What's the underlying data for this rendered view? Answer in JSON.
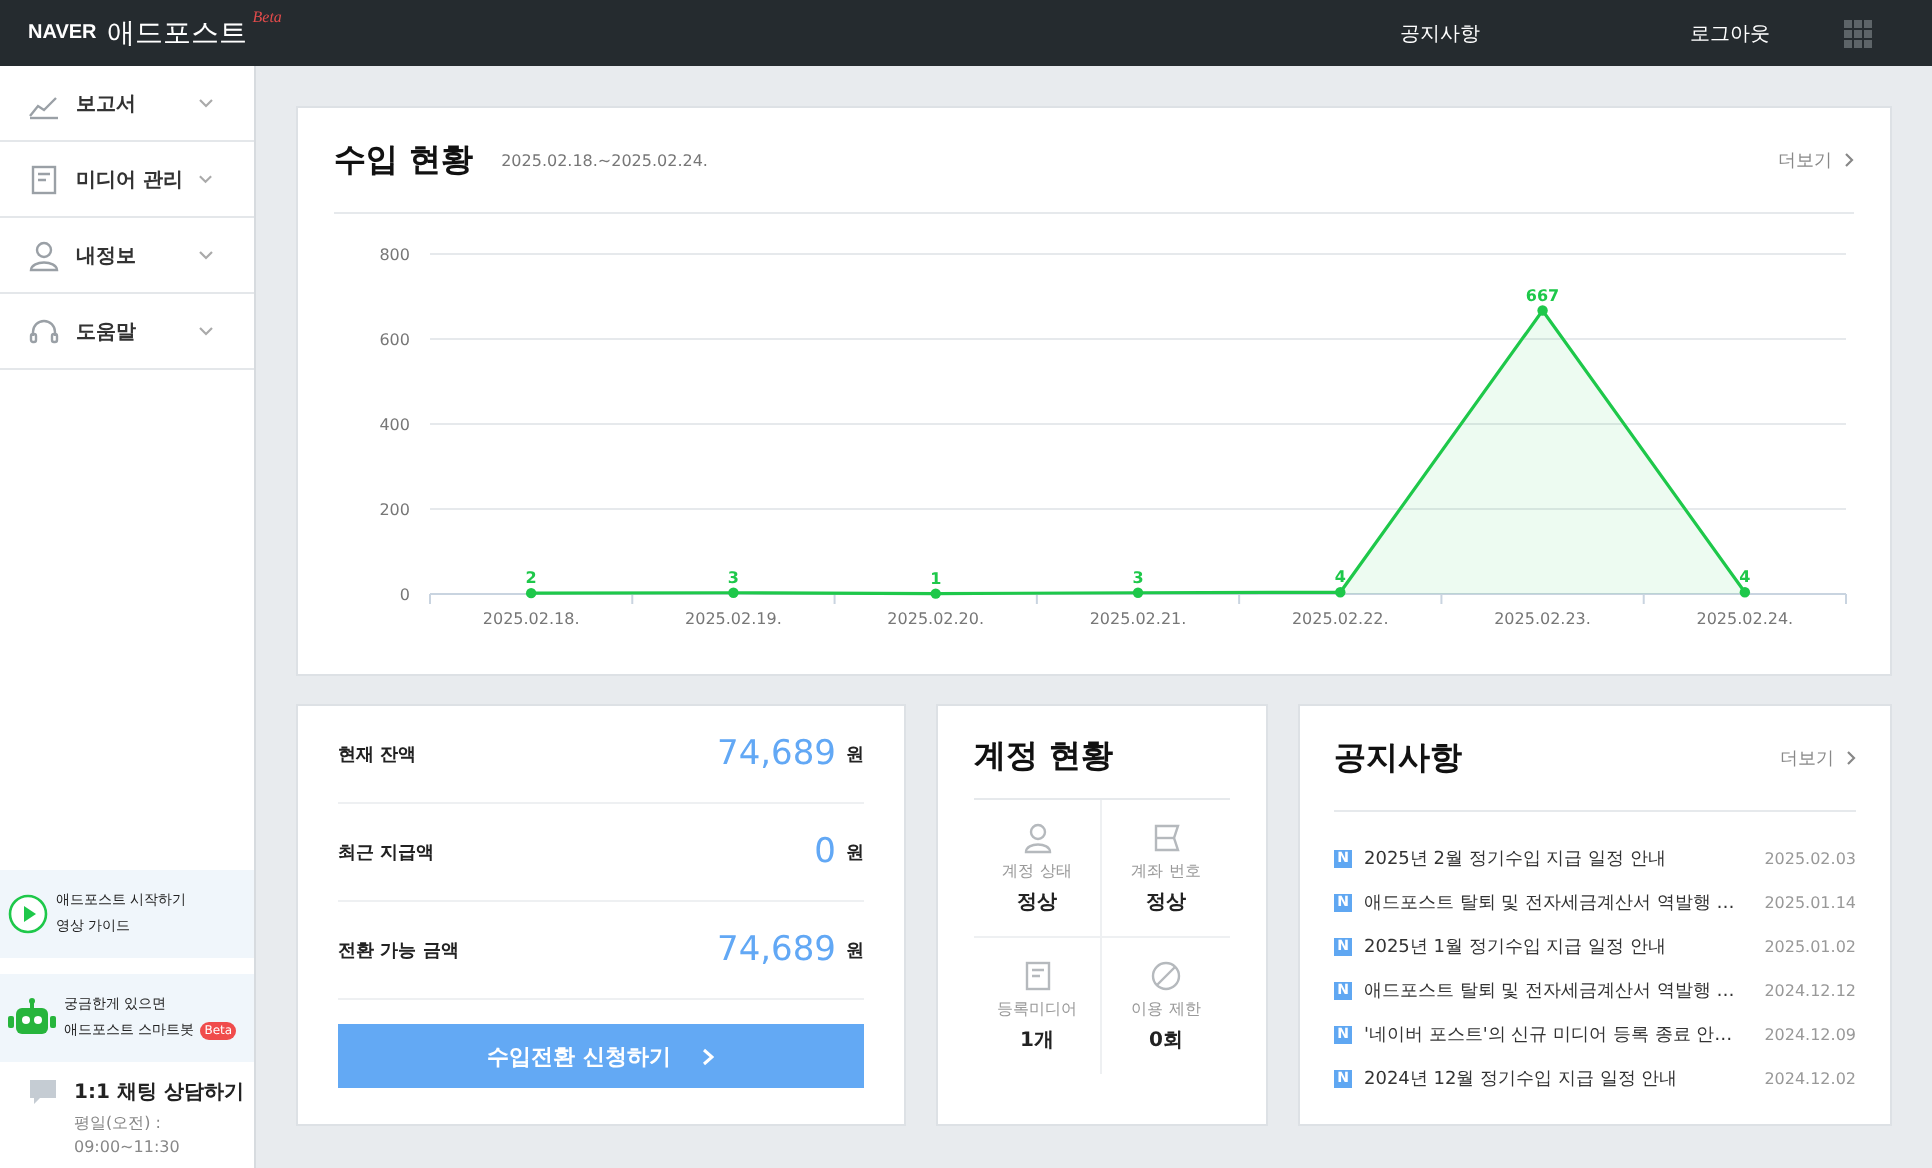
{
  "header": {
    "brand": "NAVER",
    "product": "애드포스트",
    "beta": "Beta",
    "links": [
      "공지사항",
      "로그아웃"
    ]
  },
  "sidebar": {
    "menu": [
      {
        "label": "보고서",
        "kind": "chart"
      },
      {
        "label": "미디어 관리",
        "kind": "document"
      },
      {
        "label": "내정보",
        "kind": "person"
      },
      {
        "label": "도움말",
        "kind": "headset"
      }
    ],
    "guide": [
      "애드포스트 시작하기",
      "영상 가이드"
    ],
    "bot": {
      "line1": "궁금한게 있으면",
      "line2": "애드포스트 스마트봇",
      "badge": "Beta"
    },
    "chat": {
      "title": "1:1 채팅 상담하기",
      "hours": [
        "평일(오전) :",
        "09:00~11:30"
      ]
    }
  },
  "income": {
    "title": "수입 현황",
    "period": "2025.02.18.~2025.02.24.",
    "more": "더보기",
    "chart_data": {
      "type": "area",
      "categories": [
        "2025.02.18.",
        "2025.02.19.",
        "2025.02.20.",
        "2025.02.21.",
        "2025.02.22.",
        "2025.02.23.",
        "2025.02.24."
      ],
      "series": [
        {
          "color": "#1ec84a",
          "values": [
            2,
            3,
            1,
            3,
            4,
            667,
            4
          ]
        }
      ],
      "ylim": [
        0,
        800
      ],
      "yticks": [
        0,
        200,
        400,
        600,
        800
      ],
      "grid": true,
      "data_labels": true
    }
  },
  "balance": {
    "rows": [
      {
        "label": "현재 잔액",
        "amount": "74,689",
        "unit": "원"
      },
      {
        "label": "최근 지급액",
        "amount": "0",
        "unit": "원"
      },
      {
        "label": "전환 가능 금액",
        "amount": "74,689",
        "unit": "원"
      }
    ],
    "button": "수입전환 신청하기"
  },
  "account": {
    "title": "계정 현황",
    "items": [
      {
        "kind": "person",
        "label": "계정 상태",
        "value": "정상"
      },
      {
        "kind": "card",
        "label": "계좌 번호",
        "value": "정상"
      },
      {
        "kind": "document",
        "label": "등록미디어",
        "value": "1개"
      },
      {
        "kind": "ban",
        "label": "이용 제한",
        "value": "0회"
      }
    ]
  },
  "notices": {
    "title": "공지사항",
    "more": "더보기",
    "items": [
      {
        "badge": "N",
        "title": "2025년 2월 정기수입 지급 일정 안내",
        "date": "2025.02.03"
      },
      {
        "badge": "N",
        "title": "애드포스트 탈퇴 및 전자세금계산서 역발행 …",
        "date": "2025.01.14"
      },
      {
        "badge": "N",
        "title": "2025년 1월 정기수입 지급 일정 안내",
        "date": "2025.01.02"
      },
      {
        "badge": "N",
        "title": "애드포스트 탈퇴 및 전자세금계산서 역발행 …",
        "date": "2024.12.12"
      },
      {
        "badge": "N",
        "title": "'네이버 포스트'의 신규 미디어 등록 종료 안…",
        "date": "2024.12.09"
      },
      {
        "badge": "N",
        "title": "2024년 12월 정기수입 지급 일정 안내",
        "date": "2024.12.02"
      }
    ]
  }
}
